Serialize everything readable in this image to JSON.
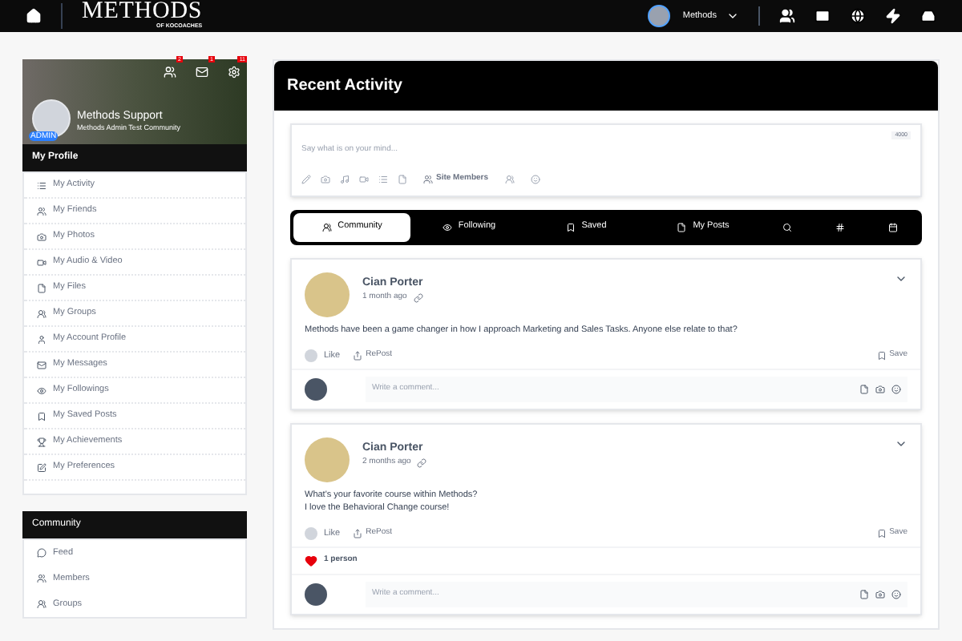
{
  "topbar": {
    "logo": "METHODS",
    "logo_sub": "OF KOCOACHES",
    "user": "Methods"
  },
  "profile": {
    "name": "Methods Support",
    "community": "Methods Admin Test Community",
    "role": "ADMIN",
    "notifications": [
      {
        "count": "2"
      },
      {
        "count": "1"
      },
      {
        "count": "11"
      }
    ]
  },
  "sidebar": {
    "title": "My Profile",
    "items": [
      {
        "label": "My Activity"
      },
      {
        "label": "My Friends"
      },
      {
        "label": "My Photos"
      },
      {
        "label": "My Audio & Video"
      },
      {
        "label": "My Files"
      },
      {
        "label": "My Groups"
      },
      {
        "label": "My Account Profile"
      },
      {
        "label": "My Messages"
      },
      {
        "label": "My Followings"
      },
      {
        "label": "My Saved Posts"
      },
      {
        "label": "My Achievements"
      },
      {
        "label": "My Preferences"
      }
    ],
    "community_title": "Community",
    "community_items": [
      {
        "label": "Feed"
      },
      {
        "label": "Members"
      },
      {
        "label": "Groups"
      }
    ]
  },
  "main": {
    "title": "Recent Activity",
    "composer": {
      "placeholder": "Say what is on your mind...",
      "counter": "4000",
      "audience": "Site Members"
    },
    "tabs": [
      {
        "kind": "community",
        "label": "Community",
        "selected": true
      },
      {
        "kind": "following",
        "label": "Following",
        "selected": false
      },
      {
        "kind": "saved",
        "label": "Saved",
        "selected": false
      },
      {
        "kind": "posts",
        "label": "My Posts",
        "selected": false
      },
      {
        "kind": "search",
        "selected": false
      },
      {
        "kind": "hashtag",
        "selected": false
      },
      {
        "kind": "calendar",
        "selected": false
      }
    ],
    "posts": [
      {
        "author": "Cian Porter",
        "time": "1 month ago",
        "lines": [
          "Methods have been a game changer in how I approach Marketing and Sales Tasks. Anyone else relate to that?"
        ],
        "like": "Like",
        "repost": "RePost",
        "save": "Save",
        "comment_placeholder": "Write a comment..."
      },
      {
        "author": "Cian Porter",
        "time": "2 months ago",
        "lines": [
          "What's your favorite course within Methods?",
          "I love the Behavioral Change course!"
        ],
        "like": "Like",
        "repost": "RePost",
        "save": "Save",
        "likes": "1 person",
        "comment_placeholder": "Write a comment..."
      }
    ]
  }
}
